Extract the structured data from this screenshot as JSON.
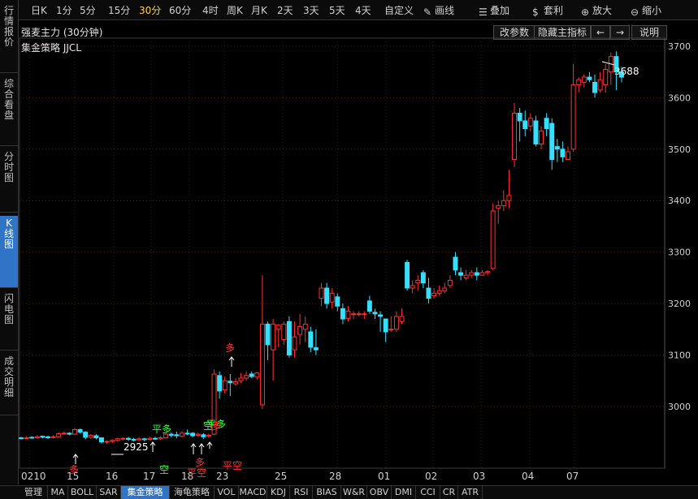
{
  "sidebar": {
    "tabs": [
      {
        "label": "行情报价",
        "active": false
      },
      {
        "label": "综合看盘",
        "active": false
      },
      {
        "label": "分时图",
        "active": false
      },
      {
        "label": "K线图",
        "active": true
      },
      {
        "label": "闪电图",
        "active": false
      },
      {
        "label": "成交明细",
        "active": false
      }
    ]
  },
  "toolbar": {
    "periods": [
      {
        "label": "日K",
        "active": false
      },
      {
        "label": "1分",
        "active": false
      },
      {
        "label": "5分",
        "active": false
      },
      {
        "label": "15分",
        "active": false
      },
      {
        "label": "30分",
        "active": true
      },
      {
        "label": "60分",
        "active": false
      },
      {
        "label": "4时",
        "active": false
      },
      {
        "label": "周K",
        "active": false
      },
      {
        "label": "月K",
        "active": false
      },
      {
        "label": "2天",
        "active": false
      },
      {
        "label": "3天",
        "active": false
      },
      {
        "label": "5天",
        "active": false
      },
      {
        "label": "4天",
        "active": false
      },
      {
        "label": "自定义",
        "active": false
      }
    ],
    "tools": [
      {
        "label": "画线",
        "icon": "pencil-icon"
      },
      {
        "label": "叠加",
        "icon": "stack-icon"
      },
      {
        "label": "套利",
        "icon": "moneybag-icon"
      },
      {
        "label": "放大",
        "icon": "zoom-in-icon"
      },
      {
        "label": "缩小",
        "icon": "zoom-out-icon"
      }
    ]
  },
  "header": {
    "title": "强麦主力 (30分钟)",
    "strategy": "集金策略 JJCL",
    "buttons": {
      "params": "改参数",
      "hide": "隐藏主指标",
      "prev": "←",
      "next": "→",
      "help": "说明"
    }
  },
  "chart_data": {
    "type": "candlestick",
    "title": "强麦主力 (30分钟)",
    "ylim": [
      2880,
      3720
    ],
    "yticks": [
      3000,
      3100,
      3200,
      3300,
      3400,
      3500,
      3600,
      3700
    ],
    "xticks": [
      "0210",
      "15",
      "16",
      "17",
      "18",
      "23",
      "25",
      "28",
      "01",
      "02",
      "03",
      "04",
      "07"
    ],
    "annotations": {
      "high_label": "3688",
      "low_label": "2925"
    },
    "signals": [
      {
        "text": "多",
        "kind": "buy"
      },
      {
        "text": "平多",
        "kind": "close_long"
      },
      {
        "text": "空",
        "kind": "sell"
      },
      {
        "text": "平空",
        "kind": "close_short"
      },
      {
        "text": "多",
        "kind": "buy"
      },
      {
        "text": "空",
        "kind": "sell"
      },
      {
        "text": "平多",
        "kind": "close_long"
      },
      {
        "text": "多",
        "kind": "buy"
      },
      {
        "text": "平空",
        "kind": "close_short"
      },
      {
        "text": "多",
        "kind": "buy"
      }
    ],
    "candles": [
      [
        2939,
        2938,
        2941,
        2936
      ],
      [
        2938,
        2939,
        2942,
        2936
      ],
      [
        2940,
        2939,
        2942,
        2937
      ],
      [
        2939,
        2941,
        2944,
        2937
      ],
      [
        2942,
        2940,
        2943,
        2938
      ],
      [
        2941,
        2939,
        2943,
        2937
      ],
      [
        2940,
        2941,
        2944,
        2938
      ],
      [
        2941,
        2947,
        2950,
        2939
      ],
      [
        2947,
        2948,
        2951,
        2945
      ],
      [
        2948,
        2946,
        2950,
        2944
      ],
      [
        2946,
        2955,
        2958,
        2944
      ],
      [
        2955,
        2950,
        2957,
        2947
      ],
      [
        2950,
        2940,
        2952,
        2936
      ],
      [
        2940,
        2944,
        2946,
        2937
      ],
      [
        2943,
        2939,
        2946,
        2936
      ],
      [
        2939,
        2931,
        2940,
        2928
      ],
      [
        2931,
        2932,
        2934,
        2927
      ],
      [
        2932,
        2934,
        2936,
        2929
      ],
      [
        2934,
        2937,
        2939,
        2931
      ],
      [
        2937,
        2938,
        2940,
        2934
      ],
      [
        2938,
        2936,
        2941,
        2933
      ],
      [
        2936,
        2935,
        2939,
        2932
      ],
      [
        2935,
        2937,
        2940,
        2933
      ],
      [
        2937,
        2936,
        2939,
        2932
      ],
      [
        2936,
        2938,
        2941,
        2934
      ],
      [
        2938,
        2937,
        2941,
        2935
      ],
      [
        2937,
        2939,
        2942,
        2935
      ],
      [
        2939,
        2946,
        2949,
        2937
      ],
      [
        2946,
        2944,
        2949,
        2940
      ],
      [
        2945,
        2943,
        2951,
        2938
      ],
      [
        2942,
        2948,
        2952,
        2940
      ],
      [
        2948,
        2947,
        2955,
        2944
      ],
      [
        2948,
        2943,
        2950,
        2940
      ],
      [
        2944,
        2946,
        2949,
        2941
      ],
      [
        2945,
        2941,
        2948,
        2937
      ],
      [
        2942,
        2944,
        2947,
        2939
      ],
      [
        2946,
        3063,
        3072,
        2944
      ],
      [
        3060,
        3030,
        3068,
        3015
      ],
      [
        3032,
        3050,
        3058,
        3025
      ],
      [
        3049,
        3046,
        3063,
        3020
      ],
      [
        3044,
        3048,
        3055,
        3040
      ],
      [
        3050,
        3055,
        3065,
        3045
      ],
      [
        3055,
        3060,
        3068,
        3050
      ],
      [
        3063,
        3058,
        3068,
        3055
      ],
      [
        3057,
        3065,
        3067,
        3052
      ],
      [
        3003,
        3160,
        3255,
        2995
      ],
      [
        3160,
        3120,
        3165,
        3090
      ],
      [
        3110,
        3160,
        3170,
        3050
      ],
      [
        3150,
        3158,
        3160,
        3115
      ],
      [
        3130,
        3160,
        3165,
        3120
      ],
      [
        3165,
        3100,
        3175,
        3095
      ],
      [
        3110,
        3135,
        3165,
        3095
      ],
      [
        3140,
        3155,
        3180,
        3120
      ],
      [
        3150,
        3160,
        3175,
        3125
      ],
      [
        3145,
        3115,
        3155,
        3105
      ],
      [
        3114,
        3110,
        3150,
        3100
      ],
      [
        3210,
        3230,
        3240,
        3195
      ],
      [
        3230,
        3200,
        3240,
        3190
      ],
      [
        3203,
        3220,
        3230,
        3190
      ],
      [
        3213,
        3195,
        3220,
        3185
      ],
      [
        3190,
        3170,
        3200,
        3160
      ],
      [
        3171,
        3185,
        3195,
        3165
      ],
      [
        3180,
        3180,
        3185,
        3170
      ],
      [
        3180,
        3180,
        3185,
        3175
      ],
      [
        3180,
        3180,
        3185,
        3170
      ],
      [
        3205,
        3185,
        3215,
        3180
      ],
      [
        3183,
        3180,
        3190,
        3170
      ],
      [
        3178,
        3175,
        3185,
        3145
      ],
      [
        3170,
        3145,
        3155,
        3125
      ],
      [
        3150,
        3150,
        3175,
        3145
      ],
      [
        3150,
        3175,
        3185,
        3145
      ],
      [
        3165,
        3175,
        3190,
        3160
      ],
      [
        3280,
        3230,
        3285,
        3225
      ],
      [
        3230,
        3235,
        3245,
        3220
      ],
      [
        3240,
        3245,
        3255,
        3225
      ],
      [
        3260,
        3240,
        3265,
        3230
      ],
      [
        3230,
        3210,
        3250,
        3200
      ],
      [
        3215,
        3220,
        3230,
        3210
      ],
      [
        3220,
        3225,
        3235,
        3215
      ],
      [
        3225,
        3230,
        3240,
        3220
      ],
      [
        3235,
        3245,
        3255,
        3230
      ],
      [
        3290,
        3265,
        3300,
        3255
      ],
      [
        3260,
        3255,
        3270,
        3245
      ],
      [
        3250,
        3255,
        3265,
        3245
      ],
      [
        3255,
        3260,
        3265,
        3250
      ],
      [
        3260,
        3255,
        3270,
        3245
      ],
      [
        3255,
        3260,
        3265,
        3255
      ],
      [
        3260,
        3262,
        3265,
        3255
      ],
      [
        3268,
        3380,
        3395,
        3265
      ],
      [
        3385,
        3390,
        3400,
        3355
      ],
      [
        3390,
        3400,
        3420,
        3380
      ],
      [
        3400,
        3410,
        3460,
        3385
      ],
      [
        3480,
        3570,
        3590,
        3465
      ],
      [
        3570,
        3555,
        3580,
        3515
      ],
      [
        3555,
        3540,
        3575,
        3525
      ],
      [
        3545,
        3560,
        3570,
        3535
      ],
      [
        3555,
        3510,
        3565,
        3505
      ],
      [
        3510,
        3535,
        3545,
        3500
      ],
      [
        3560,
        3540,
        3570,
        3525
      ],
      [
        3550,
        3480,
        3560,
        3460
      ],
      [
        3505,
        3500,
        3520,
        3475
      ],
      [
        3500,
        3485,
        3515,
        3475
      ],
      [
        3480,
        3495,
        3505,
        3480
      ],
      [
        3500,
        3625,
        3665,
        3495
      ],
      [
        3625,
        3635,
        3640,
        3610
      ],
      [
        3630,
        3640,
        3645,
        3620
      ],
      [
        3640,
        3635,
        3650,
        3630
      ],
      [
        3630,
        3610,
        3645,
        3600
      ],
      [
        3615,
        3635,
        3650,
        3610
      ],
      [
        3625,
        3655,
        3665,
        3610
      ],
      [
        3650,
        3680,
        3688,
        3625
      ],
      [
        3680,
        3650,
        3690,
        3615
      ],
      [
        3650,
        3640,
        3660,
        3630
      ]
    ]
  }
}
